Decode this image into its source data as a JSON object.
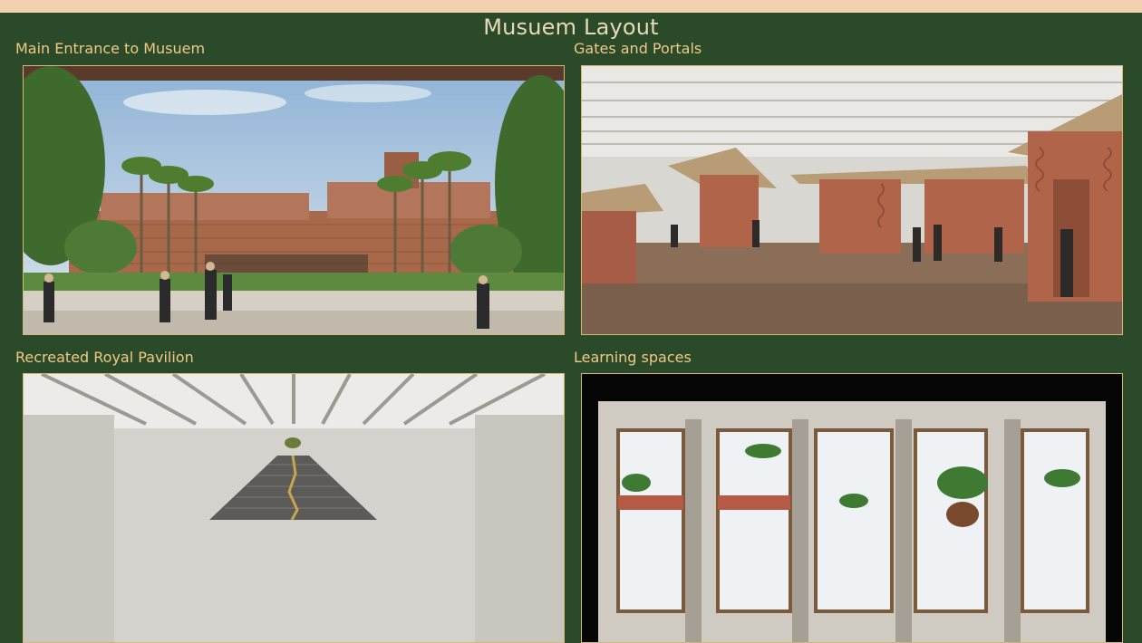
{
  "header": {
    "title": "Musuem Layout"
  },
  "gallery": {
    "items": [
      {
        "caption": "Main Entrance to Musuem",
        "image": "museum-entrance-exterior-image"
      },
      {
        "caption": "Gates and Portals",
        "image": "gates-portals-interior-image"
      },
      {
        "caption": "Recreated Royal Pavilion",
        "image": "royal-pavilion-interior-image"
      },
      {
        "caption": "Learning spaces",
        "image": "learning-spaces-interior-image"
      }
    ]
  },
  "colors": {
    "background": "#2a4a2a",
    "top_bar": "#f3d1ae",
    "caption_text": "#f0c987",
    "title_text": "#e8d9b9",
    "card_border": "#d8b86a"
  }
}
